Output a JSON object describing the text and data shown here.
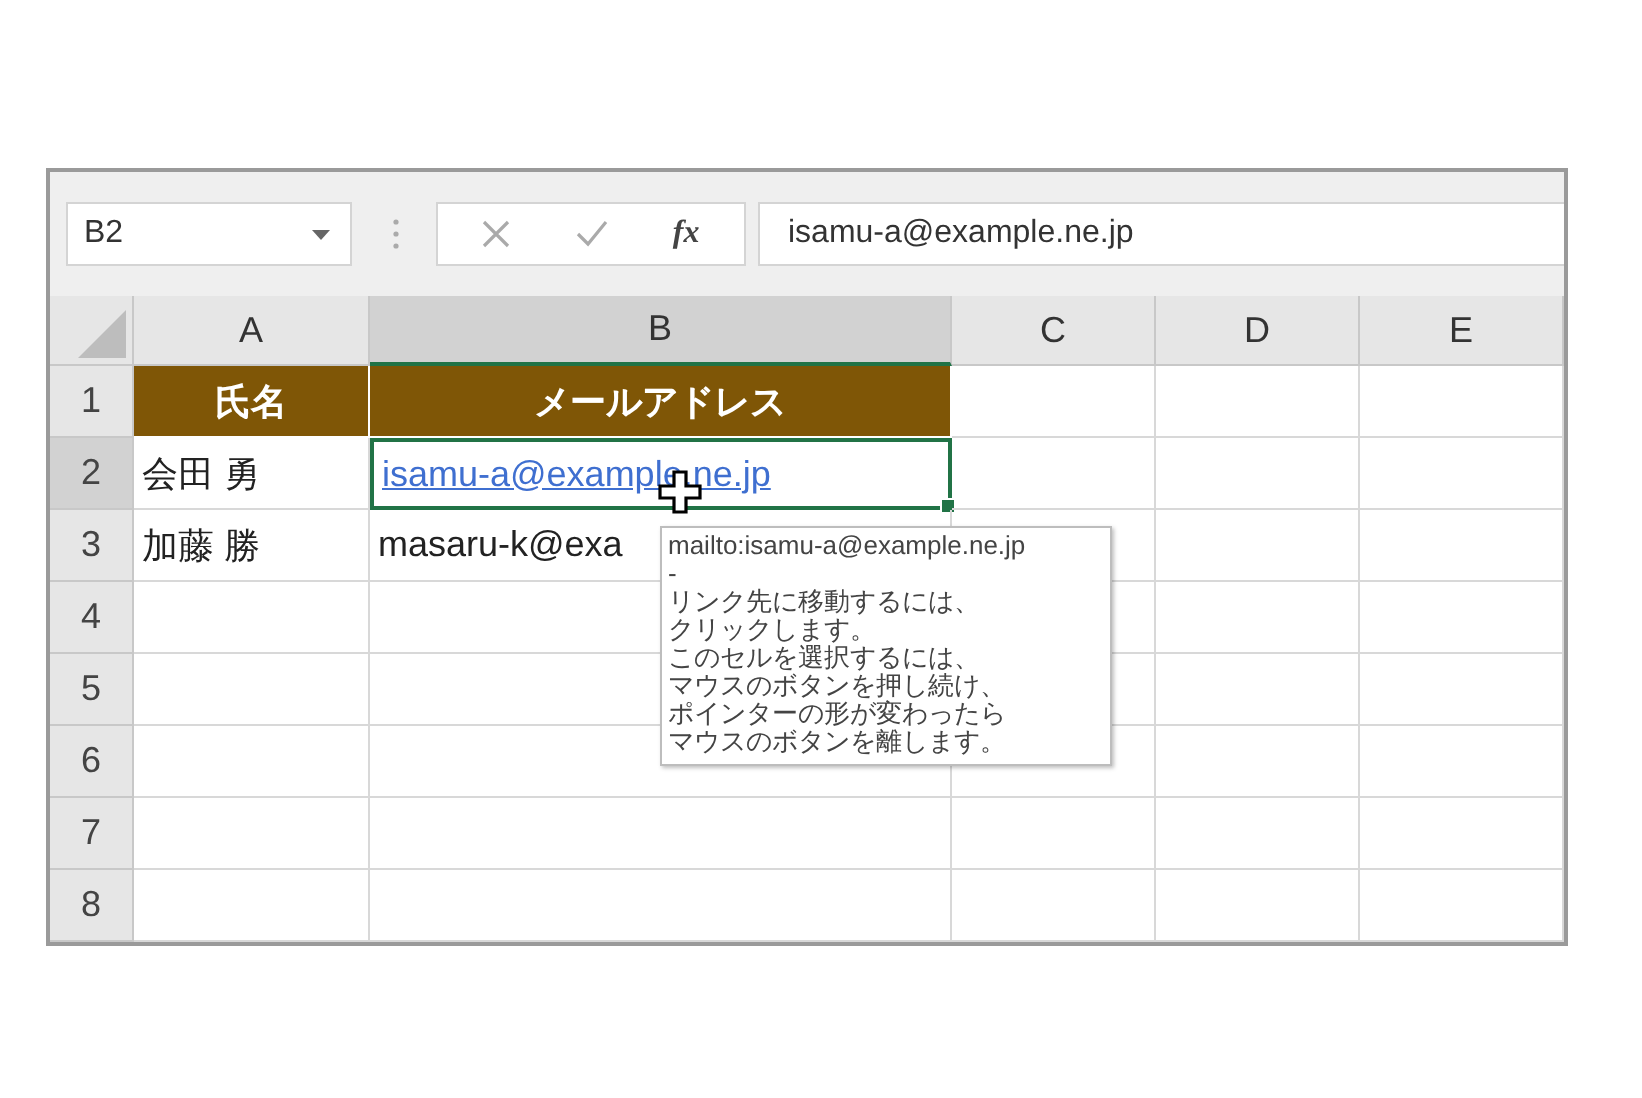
{
  "name_box": {
    "value": "B2"
  },
  "formula_bar": {
    "function_label": "fx",
    "value": "isamu-a@example.ne.jp"
  },
  "columns": [
    {
      "label": "A",
      "selected": false
    },
    {
      "label": "B",
      "selected": true
    },
    {
      "label": "C",
      "selected": false
    },
    {
      "label": "D",
      "selected": false
    },
    {
      "label": "E",
      "selected": false
    }
  ],
  "rows": [
    {
      "label": "1",
      "selected": false,
      "cells": [
        {
          "kind": "header",
          "text": "氏名",
          "selected": false
        },
        {
          "kind": "header",
          "text": "メールアドレス",
          "selected": false
        }
      ]
    },
    {
      "label": "2",
      "selected": true,
      "cells": [
        {
          "kind": "text",
          "text": "会田 勇",
          "selected": false
        },
        {
          "kind": "link",
          "text": "isamu-a@example.ne.jp",
          "selected": true
        }
      ]
    },
    {
      "label": "3",
      "selected": false,
      "cells": [
        {
          "kind": "text",
          "text": "加藤 勝",
          "selected": false
        },
        {
          "kind": "text",
          "text": "masaru-k@exa",
          "selected": false
        }
      ]
    },
    {
      "label": "4",
      "selected": false
    },
    {
      "label": "5",
      "selected": false
    },
    {
      "label": "6",
      "selected": false
    },
    {
      "label": "7",
      "selected": false
    },
    {
      "label": "8",
      "selected": false
    }
  ],
  "tooltip": {
    "url": "mailto:isamu-a@example.ne.jp",
    "separator": "-",
    "lines": [
      "リンク先に移動するには、",
      "クリックします。",
      "このセルを選択するには、",
      "マウスのボタンを押し続け、",
      "ポインターの形が変わったら",
      "マウスのボタンを離します。"
    ]
  }
}
